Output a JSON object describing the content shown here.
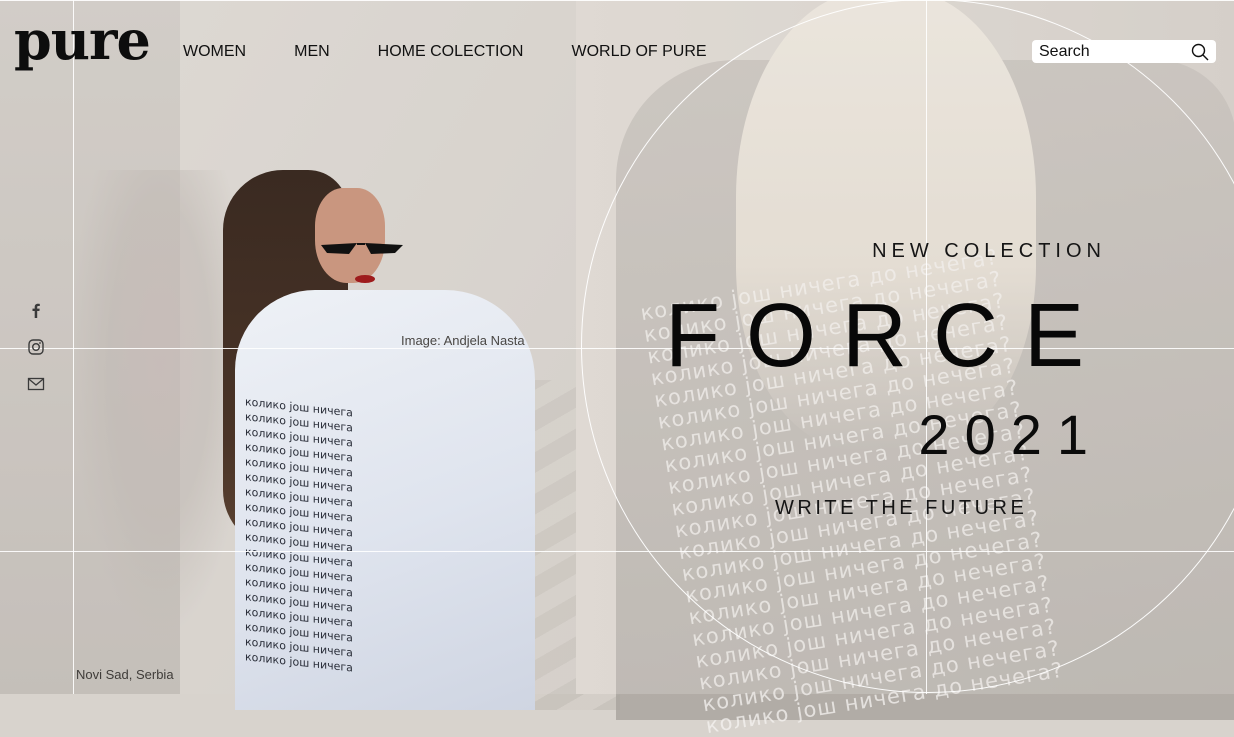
{
  "brand": {
    "logo_text": "pure"
  },
  "nav": {
    "items": [
      {
        "label": "WOMEN"
      },
      {
        "label": "MEN"
      },
      {
        "label": "HOME COLECTION"
      },
      {
        "label": "WORLD OF PURE"
      }
    ]
  },
  "search": {
    "placeholder": "Search",
    "icon": "search-icon"
  },
  "social": {
    "icons": [
      "facebook-icon",
      "instagram-icon",
      "mail-icon"
    ]
  },
  "hero": {
    "image_credit": "Image: Andjela Nasta",
    "eyebrow": "NEW COLECTION",
    "title": "FORCE",
    "year": "2021",
    "tagline": "WRITE THE FUTURE",
    "location": "Novi Sad, Serbia"
  },
  "photo": {
    "shirt_print_line": "колико још ничега до нечега?"
  },
  "colors": {
    "text": "#111111",
    "grid_lines": "#ffffff",
    "search_bg": "#ffffff"
  }
}
